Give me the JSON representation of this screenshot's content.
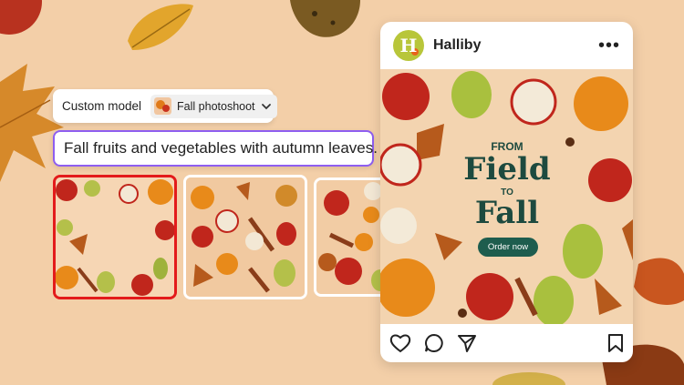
{
  "colors": {
    "background": "#f3cfa8",
    "selected_border": "#e31b1b",
    "prompt_border": "#8e5ef0",
    "ad_text": "#1d4a3f",
    "ad_button": "#1e5d4e"
  },
  "model_bar": {
    "label": "Custom model",
    "selected_model": "Fall photoshoot",
    "dropdown_icon": "chevron-down-icon"
  },
  "prompt": {
    "value": "Fall fruits and vegetables with autumn leaves."
  },
  "generated_images": [
    {
      "selected": true
    },
    {
      "selected": false
    },
    {
      "selected": false
    }
  ],
  "post": {
    "avatar_letter": "H",
    "username": "Halliby",
    "more_icon": "more-horizontal-icon",
    "ad": {
      "line1": "FROM",
      "line2": "Field",
      "line3": "TO",
      "line4": "Fall",
      "button": "Order now"
    },
    "actions": [
      "heart-icon",
      "comment-icon",
      "send-icon",
      "bookmark-icon"
    ]
  }
}
